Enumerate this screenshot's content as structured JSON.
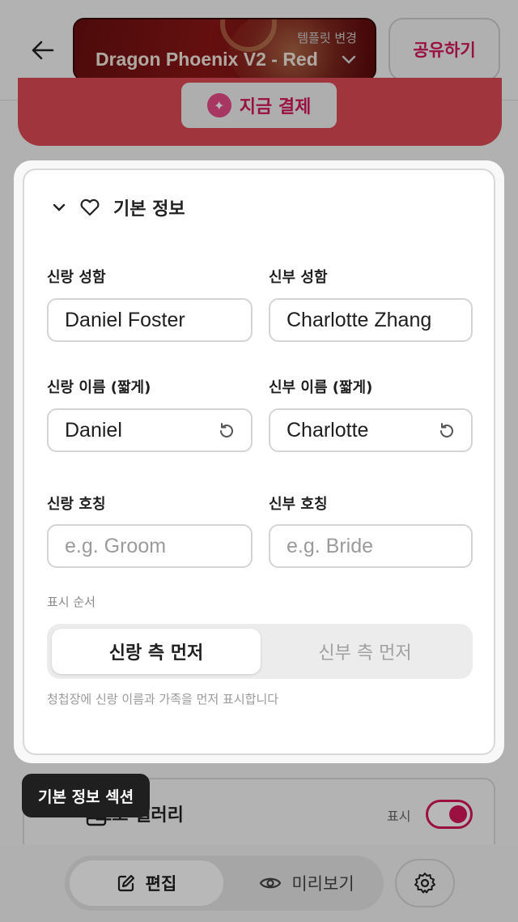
{
  "header": {
    "template_change_label": "템플릿 변경",
    "template_name": "Dragon Phoenix V2 - Red",
    "share_label": "공유하기",
    "pay_label": "지금 결제"
  },
  "section": {
    "title": "기본 정보",
    "groom_name_label": "신랑 성함",
    "bride_name_label": "신부 성함",
    "groom_name_value": "Daniel Foster",
    "bride_name_value": "Charlotte Zhang",
    "groom_short_label": "신랑 이름 (짧게)",
    "bride_short_label": "신부 이름 (짧게)",
    "groom_short_value": "Daniel",
    "bride_short_value": "Charlotte",
    "groom_title_label": "신랑 호칭",
    "bride_title_label": "신부 호칭",
    "groom_title_placeholder": "e.g. Groom",
    "bride_title_placeholder": "e.g. Bride",
    "order_label": "표시 순서",
    "order_options": [
      "신랑 측 먼저",
      "신부 측 먼저"
    ],
    "order_selected": "신랑 측 먼저",
    "hint": "청첩장에 신랑 이름과 가족을 먼저 표시합니다"
  },
  "tooltip": "기본 정보 섹션",
  "gallery": {
    "title": "포토 갤러리",
    "show_label": "표시",
    "enabled": true
  },
  "bottom_nav": {
    "edit_label": "편집",
    "preview_label": "미리보기",
    "active": "편집"
  },
  "colors": {
    "accent": "#d4175a",
    "banner": "#e04a56",
    "template_bg": "#7a1212"
  }
}
